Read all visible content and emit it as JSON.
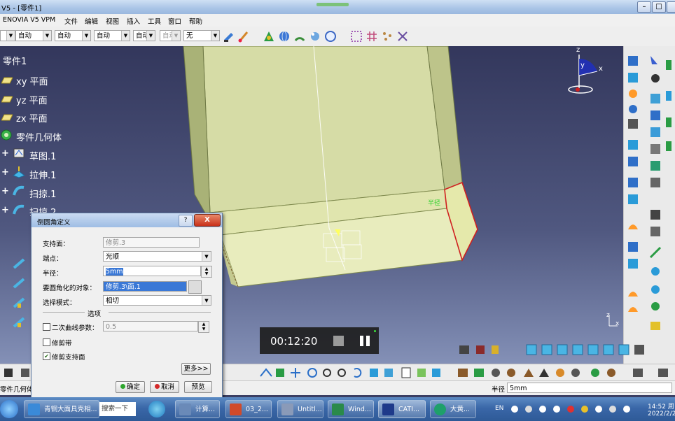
{
  "window": {
    "title": "V5 - [零件1]"
  },
  "menubar": [
    "ENOVIA V5 VPM",
    "文件",
    "编辑",
    "视图",
    "插入",
    "工具",
    "窗口",
    "帮助"
  ],
  "toolbar": {
    "combos": [
      "自动",
      "自动",
      "自动",
      "自动",
      "自动",
      "无"
    ]
  },
  "tree": {
    "root": "零件1",
    "items": [
      "xy 平面",
      "yz 平面",
      "zx 平面",
      "零件几何体",
      "草图.1",
      "拉伸.1",
      "扫掠.1",
      "扫掠.2"
    ]
  },
  "compass": {
    "x": "x",
    "y": "y",
    "z": "z"
  },
  "axis_small": {
    "z": "z",
    "x": "x"
  },
  "viewport_label": "半径",
  "dialog": {
    "title": "倒圆角定义",
    "help": "?",
    "close": "X",
    "support_label": "支持面：",
    "support_value": "修剪.3",
    "ends_label": "端点：",
    "ends_value": "光顺",
    "radius_label": "半径：",
    "radius_value": "5mm",
    "objects_label": "要圆角化的对象：",
    "objects_value": "修剪.3\\面.1",
    "mode_label": "选择模式：",
    "mode_value": "相切",
    "options_label": "选项",
    "conic_label": "二次曲线参数：",
    "conic_value": "0.5",
    "ribbon_label": "修剪带",
    "trim_label": "修剪支持面",
    "conic_checked": false,
    "ribbon_checked": false,
    "trim_checked": true,
    "more_button": "更多>>",
    "ok_button": "确定",
    "cancel_button": "取消",
    "preview_button": "预览"
  },
  "video": {
    "time": "00:12:20"
  },
  "statusbar": {
    "left": "零件几何体",
    "radius_label": "半径",
    "radius_value": "5mm"
  },
  "taskbar": {
    "search": "搜索一下",
    "browser": "青铜大面具壳相...",
    "tasks": [
      "计算...",
      "03_2...",
      "Untitl...",
      "Wind...",
      "CATI...",
      "大黄..."
    ],
    "lang": "EN",
    "time": "14:52 周",
    "date": "2022/2/2"
  }
}
